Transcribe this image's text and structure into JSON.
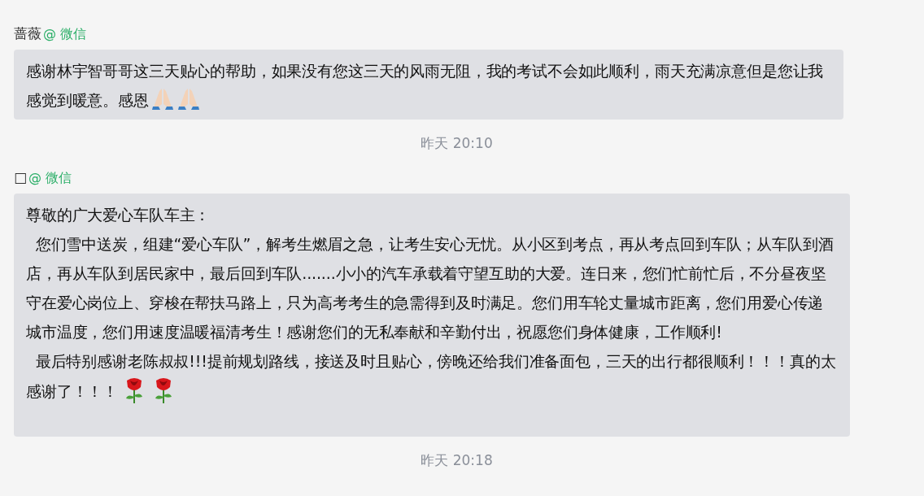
{
  "messages": [
    {
      "kind": "message",
      "sender": "蔷薇",
      "source": "@ 微信",
      "paragraphs": [
        {
          "parts": [
            {
              "kind": "text",
              "text": "感谢林宇智哥哥这三天贴心的帮助，如果没有您这三天的风雨无阻，我的考试不会如此顺利，雨天充满凉意但是您让我感觉到暖意。感恩"
            },
            {
              "kind": "pray"
            },
            {
              "kind": "pray"
            }
          ]
        }
      ]
    },
    {
      "kind": "time",
      "text": "昨天 20:10"
    },
    {
      "kind": "message",
      "sender": "□",
      "source": "@ 微信",
      "tall": true,
      "paragraphs": [
        {
          "parts": [
            {
              "kind": "text",
              "text": "尊敬的广大爱心车队车主："
            }
          ]
        },
        {
          "parts": [
            {
              "kind": "text",
              "text": "  您们雪中送炭，组建“爱心车队”，解考生燃眉之急，让考生安心无忧。从小区到考点，再从考点回到车队；从车队到酒店，再从车队到居民家中，最后回到车队.......小小的汽车承载着守望互助的大爱。连日来，您们忙前忙后，不分昼夜坚守在爱心岗位上、穿梭在帮扶马路上，只为高考考生的急需得到及时满足。您们用车轮丈量城市距离，您们用爱心传递城市温度，您们用速度温暖福清考生！感谢您们的无私奉献和辛勤付出，祝愿您们身体健康，工作顺利!"
            }
          ]
        },
        {
          "parts": [
            {
              "kind": "text",
              "text": "  最后特别感谢老陈叔叔!!!提前规划路线，接送及时且贴心，傍晚还给我们准备面包，三天的出行都很顺利！！！真的太感谢了！！！"
            },
            {
              "kind": "rose"
            },
            {
              "kind": "rose"
            }
          ]
        }
      ]
    },
    {
      "kind": "time",
      "text": "昨天 20:18"
    }
  ]
}
